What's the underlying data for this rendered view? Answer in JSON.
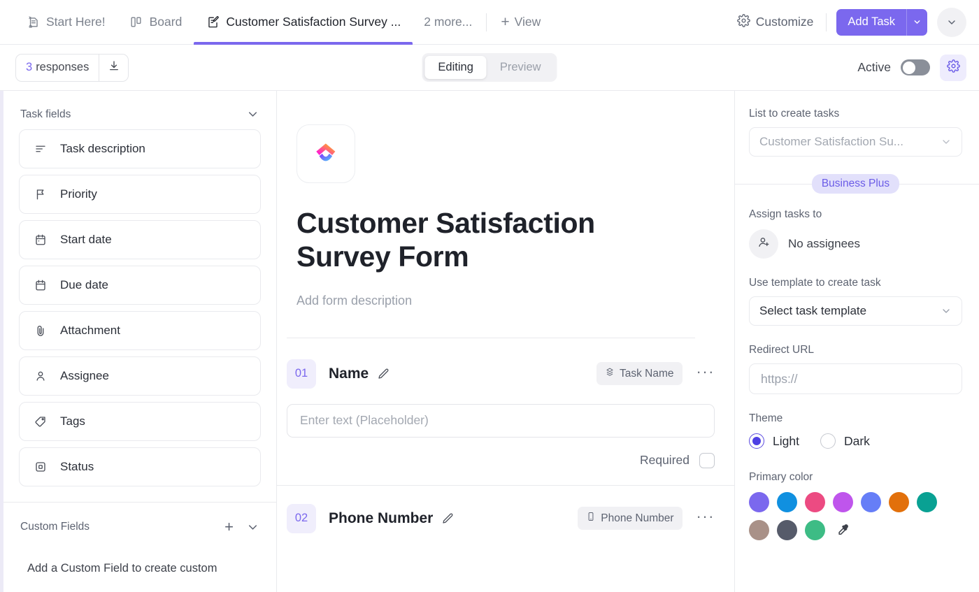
{
  "topbar": {
    "tabs": [
      {
        "label": "Start Here!",
        "icon": "pinned-doc-icon",
        "active": false
      },
      {
        "label": "Board",
        "icon": "board-icon",
        "active": false
      },
      {
        "label": "Customer Satisfaction Survey ...",
        "icon": "form-icon",
        "active": true
      }
    ],
    "more_label": "2 more...",
    "add_view_label": "View",
    "customize_label": "Customize",
    "add_task_label": "Add Task",
    "accent_color": "#7b68ee"
  },
  "subbar": {
    "responses_count": "3",
    "responses_label": "responses",
    "download_icon": "download-icon",
    "segmented": [
      {
        "label": "Editing",
        "active": true
      },
      {
        "label": "Preview",
        "active": false
      }
    ],
    "active_label": "Active",
    "active_on": false,
    "settings_icon": "gear-icon"
  },
  "sidebar": {
    "task_fields_title": "Task fields",
    "fields": [
      {
        "label": "Task description",
        "icon": "text-lines-icon"
      },
      {
        "label": "Priority",
        "icon": "flag-icon"
      },
      {
        "label": "Start date",
        "icon": "calendar-icon"
      },
      {
        "label": "Due date",
        "icon": "calendar-icon"
      },
      {
        "label": "Attachment",
        "icon": "paperclip-icon"
      },
      {
        "label": "Assignee",
        "icon": "person-icon"
      },
      {
        "label": "Tags",
        "icon": "tag-icon"
      },
      {
        "label": "Status",
        "icon": "status-square-icon"
      }
    ],
    "custom_fields_title": "Custom Fields",
    "custom_fields_empty": "Add a Custom Field to create custom"
  },
  "form": {
    "logo": "clickup-logo",
    "title": "Customer Satisfaction Survey Form",
    "description_placeholder": "Add form description",
    "questions": [
      {
        "number": "01",
        "title": "Name",
        "tag": "Task Name",
        "tag_icon": "task-name-icon",
        "input_placeholder": "Enter text (Placeholder)",
        "required_label": "Required",
        "required_checked": false
      },
      {
        "number": "02",
        "title": "Phone Number",
        "tag": "Phone Number",
        "tag_icon": "phone-icon"
      }
    ]
  },
  "rightpanel": {
    "list_label": "List to create tasks",
    "list_value": "Customer Satisfaction Su...",
    "plan_badge": "Business Plus",
    "assign_label": "Assign tasks to",
    "assign_value": "No assignees",
    "template_label": "Use template to create task",
    "template_value": "Select task template",
    "redirect_label": "Redirect URL",
    "redirect_placeholder": "https://",
    "theme_label": "Theme",
    "theme_options": [
      {
        "label": "Light",
        "selected": true
      },
      {
        "label": "Dark",
        "selected": false
      }
    ],
    "primary_color_label": "Primary color",
    "primary_colors": [
      "#7b68ee",
      "#1090e0",
      "#ec4b82",
      "#bf55ec",
      "#667ef7",
      "#e2700b",
      "#09a193",
      "#a99188",
      "#565b6a",
      "#3dbc85"
    ],
    "eyedropper_icon": "eyedropper-icon"
  }
}
